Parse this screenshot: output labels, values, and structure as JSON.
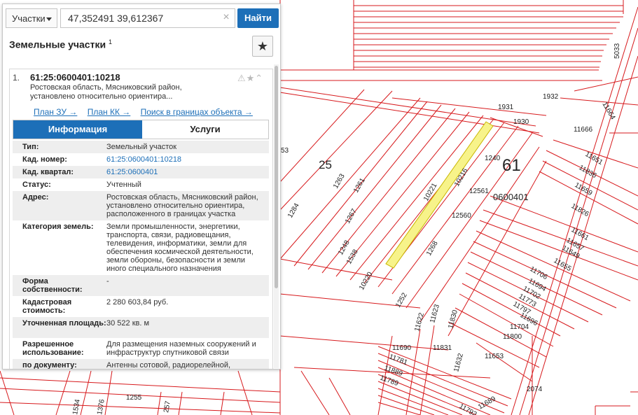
{
  "search": {
    "type_label": "Участки",
    "query": "47,352491 39,612367",
    "clear_symbol": "×",
    "find_label": "Найти"
  },
  "panel": {
    "title": "Земельные участки",
    "title_sup": "1",
    "favorite_symbol": "★"
  },
  "card": {
    "number": "1.",
    "cadastral_id": "61:25:0600401:10218",
    "address_short": "Ростовская область, Мясниковский район, установлено относительно ориентира...",
    "icons": "⚠★⌃",
    "links": [
      "План ЗУ →",
      "План КК →",
      "Поиск в границах объекта →"
    ],
    "tabs": {
      "info": "Информация",
      "services": "Услуги"
    }
  },
  "properties": [
    {
      "label": "Тип:",
      "value": "Земельный участок"
    },
    {
      "label": "Кад. номер:",
      "value": "61:25:0600401:10218"
    },
    {
      "label": "Кад. квартал:",
      "value": "61:25:0600401"
    },
    {
      "label": "Статус:",
      "value": "Учтенный"
    },
    {
      "label": "Адрес:",
      "value": "Ростовская область, Мясниковский район, установлено относительно ориентира, расположенного в границах участка"
    },
    {
      "label": "Категория земель:",
      "value": "Земли промышленности, энергетики, транспорта, связи, радиовещания, телевидения, информатики, земли для обеспечения космической деятельности, земли обороны, безопасности и земли иного специального назначения"
    },
    {
      "label": "Форма собственности:",
      "value": "-"
    },
    {
      "label": "Кадастровая стоимость:",
      "value": "2 280 603,84 руб."
    },
    {
      "label": "Уточненная площадь:",
      "value": "30 522 кв. м"
    },
    {
      "label": "Разрешенное использование:",
      "value": "Для размещения наземных сооружений и инфраструктур спутниковой связи"
    },
    {
      "label": "по документу:",
      "value": "Антенны сотовой, радиорелейной,"
    }
  ],
  "map": {
    "region_label": "61",
    "district_label": "25",
    "quarter_label": "0600401",
    "parcel_labels": [
      "1932",
      "1931",
      "1930",
      "11664",
      "5033",
      "11666",
      "1240",
      "11651",
      "11836",
      "11659",
      "11826",
      "12561",
      "12560",
      "10216",
      "10221",
      "1263",
      "1261",
      "1267",
      "1248",
      "1538",
      "1284",
      "10220",
      "1268",
      "1252",
      "11661",
      "11657",
      "11649",
      "11655",
      "11706",
      "11694",
      "11702",
      "11773",
      "11797",
      "11696",
      "11704",
      "11800",
      "11623",
      "11830",
      "11622",
      "11831",
      "11653",
      "11690",
      "11781",
      "11889",
      "11789",
      "11632",
      "2074",
      "11792",
      "11689",
      "1255",
      "257",
      "1534",
      "1376",
      "53"
    ],
    "colors": {
      "boundary": "#d7191c",
      "highlight": "#f7f38a",
      "accent": "#1d6fb8"
    }
  }
}
